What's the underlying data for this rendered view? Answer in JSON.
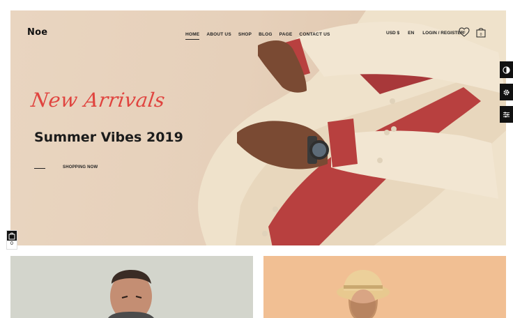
{
  "header": {
    "logo": "Noe",
    "nav": [
      "HOME",
      "ABOUT US",
      "SHOP",
      "BLOG",
      "PAGE",
      "CONTACT US"
    ],
    "currency": "USD $",
    "language": "EN",
    "account": "LOGIN / REGISTER",
    "wishlist_count": "0",
    "cart_count": "0"
  },
  "hero": {
    "script": "New Arrivals",
    "title": "Summer Vibes 2019",
    "cta": "SHOPPING NOW"
  },
  "mini_cart": {
    "count": "0"
  },
  "colors": {
    "accent": "#e0443f",
    "hero_bg": "#e8d4bf",
    "card_left": "#d3d5cc",
    "card_right": "#f1bf93",
    "side_tab": "#111111"
  }
}
